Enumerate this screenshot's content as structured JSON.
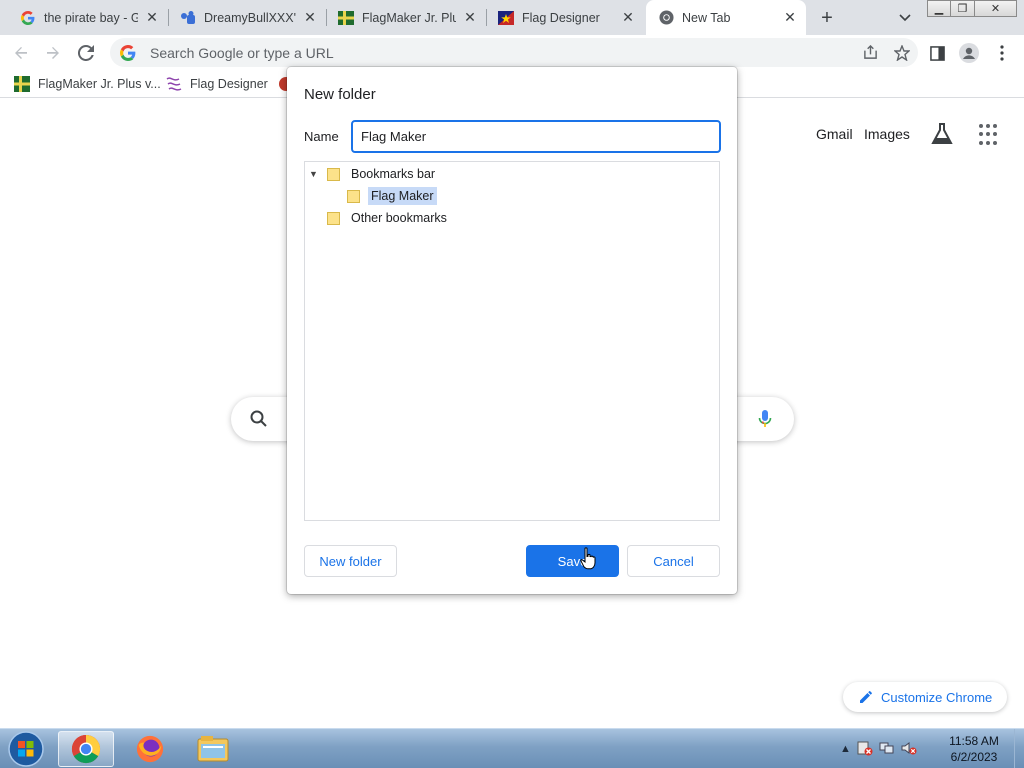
{
  "tabs": [
    {
      "title": "the pirate bay - Go",
      "icon": "google-icon"
    },
    {
      "title": "DreamyBullXXX's",
      "icon": "deviantart-icon"
    },
    {
      "title": "FlagMaker Jr. Plus",
      "icon": "flagmaker-icon"
    },
    {
      "title": "Flag Designer",
      "icon": "flag-designer-icon"
    },
    {
      "title": "New Tab",
      "icon": "chrome-icon"
    }
  ],
  "toolbar": {
    "omnibox_placeholder": "Search Google or type a URL"
  },
  "bookmarks": [
    {
      "label": "FlagMaker Jr. Plus v...",
      "icon": "flagmaker-icon"
    },
    {
      "label": "Flag Designer",
      "icon": "flag-designer-icon"
    }
  ],
  "ntp": {
    "gmail": "Gmail",
    "images": "Images",
    "customize": "Customize Chrome"
  },
  "dialog": {
    "title": "New folder",
    "name_label": "Name",
    "name_value": "Flag Maker",
    "tree": [
      {
        "label": "Bookmarks bar",
        "expanded": true,
        "level": 0
      },
      {
        "label": "Flag Maker",
        "selected": true,
        "level": 1
      },
      {
        "label": "Other bookmarks",
        "level": 0
      }
    ],
    "new_folder": "New folder",
    "save": "Save",
    "cancel": "Cancel"
  },
  "taskbar": {
    "time": "11:58 AM",
    "date": "6/2/2023"
  },
  "colors": {
    "accent": "#1a73e8",
    "tabstrip": "#dee1e6",
    "selection": "#c7daf7"
  }
}
